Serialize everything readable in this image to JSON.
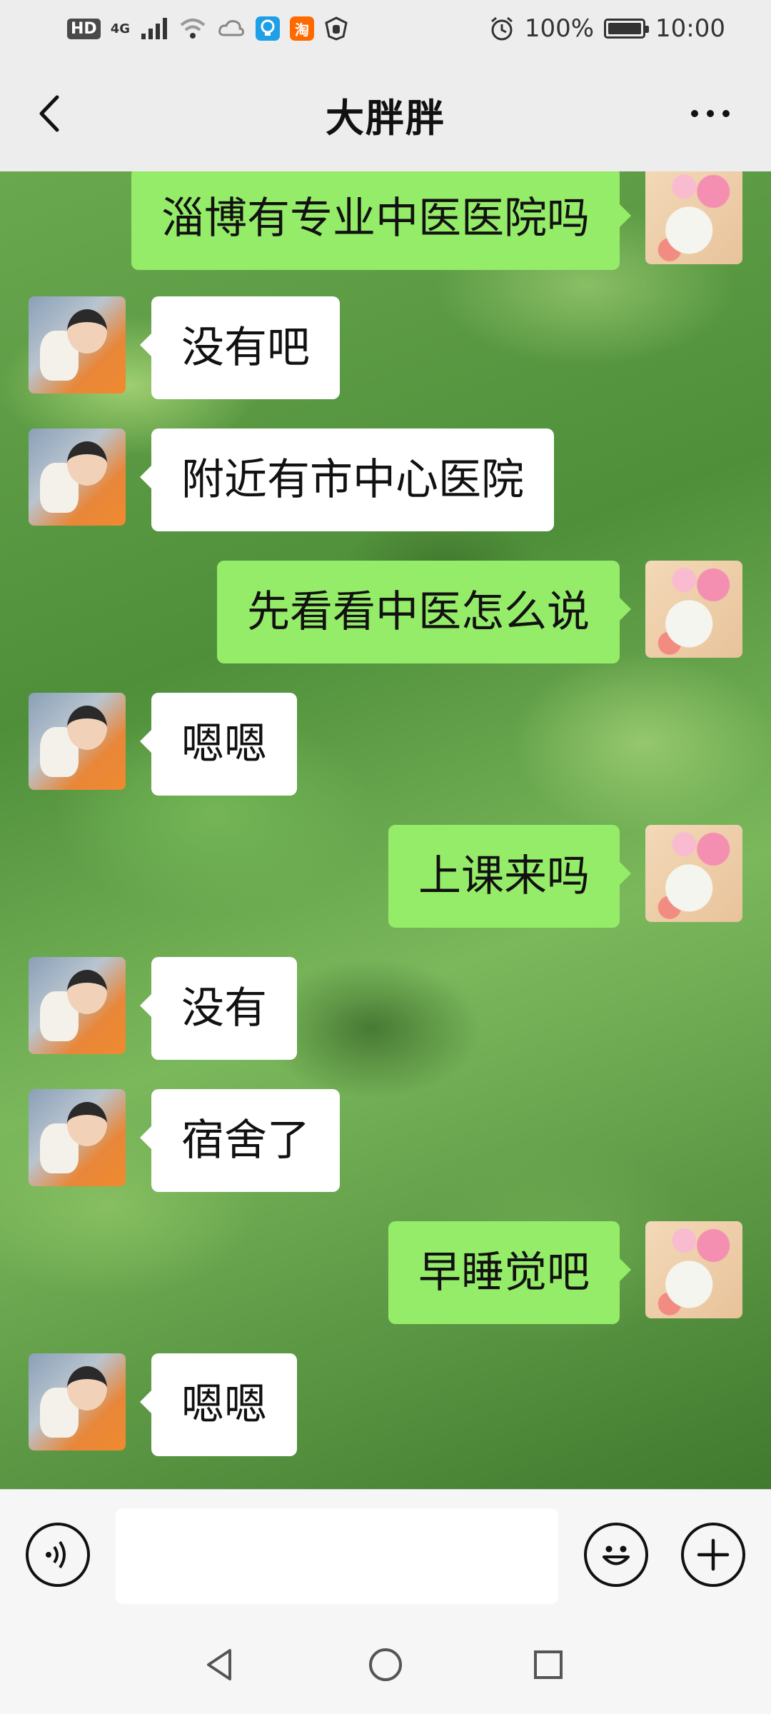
{
  "status_bar": {
    "hd_badge": "HD",
    "network": "4G",
    "app_taobao": "淘",
    "battery_percent": "100%",
    "battery_level": 1.0,
    "time": "10:00"
  },
  "header": {
    "title": "大胖胖"
  },
  "messages": [
    {
      "side": "right",
      "sender": "self",
      "text": "淄博有专业中医医院吗"
    },
    {
      "side": "left",
      "sender": "friend",
      "text": "没有吧"
    },
    {
      "side": "left",
      "sender": "friend",
      "text": "附近有市中心医院"
    },
    {
      "side": "right",
      "sender": "self",
      "text": "先看看中医怎么说"
    },
    {
      "side": "left",
      "sender": "friend",
      "text": "嗯嗯"
    },
    {
      "side": "right",
      "sender": "self",
      "text": "上课来吗"
    },
    {
      "side": "left",
      "sender": "friend",
      "text": "没有"
    },
    {
      "side": "left",
      "sender": "friend",
      "text": "宿舍了"
    },
    {
      "side": "right",
      "sender": "self",
      "text": "早睡觉吧"
    },
    {
      "side": "left",
      "sender": "friend",
      "text": "嗯嗯"
    }
  ],
  "input_bar": {
    "value": "",
    "placeholder": "",
    "icons": [
      "voice-icon",
      "emoji-icon",
      "plus-icon"
    ]
  },
  "system_nav": {
    "icons": [
      "back-triangle-icon",
      "home-circle-icon",
      "recents-square-icon"
    ]
  },
  "colors": {
    "self_bubble": "#95ec69",
    "friend_bubble": "#ffffff",
    "header_bg": "#ededed"
  }
}
